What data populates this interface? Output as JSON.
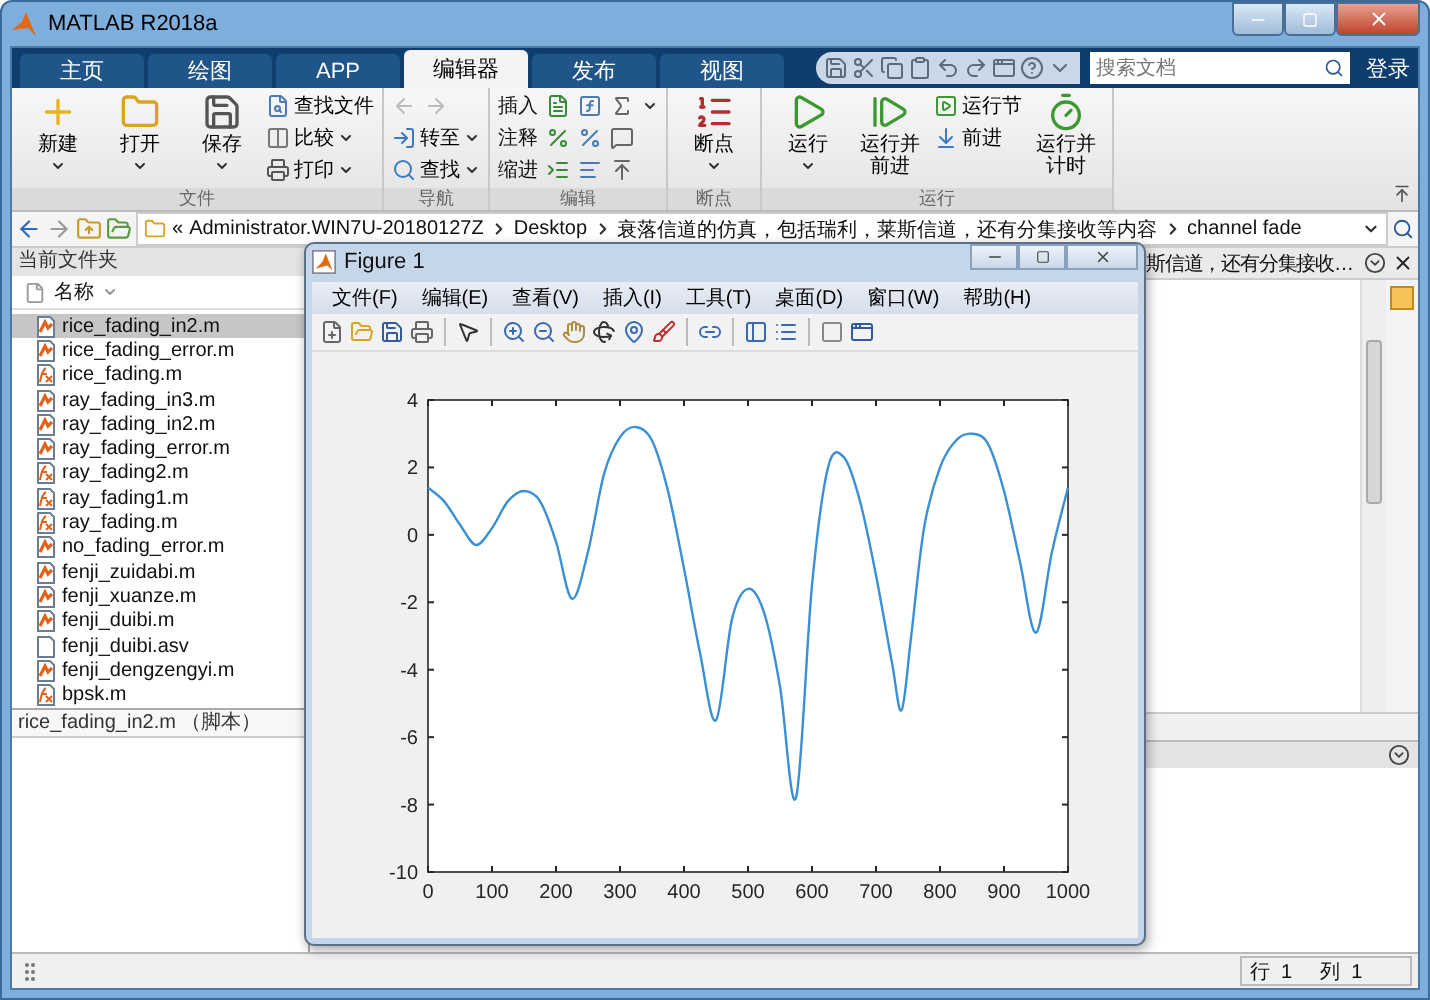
{
  "window": {
    "title": "MATLAB R2018a"
  },
  "tabs": [
    {
      "label": "主页",
      "selected": false
    },
    {
      "label": "绘图",
      "selected": false
    },
    {
      "label": "APP",
      "selected": false
    },
    {
      "label": "编辑器",
      "selected": true
    },
    {
      "label": "发布",
      "selected": false
    },
    {
      "label": "视图",
      "selected": false
    }
  ],
  "search": {
    "placeholder": "搜索文档"
  },
  "login": "登录",
  "ribbon": [
    {
      "title": "文件",
      "columns": [
        {
          "kind": "large",
          "label": "新建",
          "dropdown": true
        },
        {
          "kind": "large",
          "label": "打开",
          "dropdown": true
        },
        {
          "kind": "large",
          "label": "保存",
          "dropdown": true
        },
        {
          "kind": "stack",
          "rows": [
            {
              "kind": "button",
              "label": "查找文件",
              "dropdown": false
            },
            {
              "kind": "button",
              "label": "比较",
              "dropdown": true
            },
            {
              "kind": "button",
              "label": "打印",
              "dropdown": true
            }
          ]
        }
      ]
    },
    {
      "title": "导航",
      "columns": [
        {
          "kind": "stack",
          "rows": [
            {
              "kind": "arrows",
              "disabled": true
            },
            {
              "kind": "button",
              "label": "转至",
              "dropdown": true
            },
            {
              "kind": "button",
              "label": "查找",
              "dropdown": true
            }
          ]
        }
      ]
    },
    {
      "title": "编辑",
      "columns": [
        {
          "kind": "stack",
          "rows": [
            {
              "kind": "edit",
              "label": "插入",
              "dropdown": true
            },
            {
              "kind": "edit",
              "label": "注释",
              "dropdown": false
            },
            {
              "kind": "edit",
              "label": "缩进",
              "dropdown": false
            }
          ]
        }
      ]
    },
    {
      "title": "断点",
      "columns": [
        {
          "kind": "large",
          "label": "断点",
          "dropdown": true
        }
      ]
    },
    {
      "title": "运行",
      "columns": [
        {
          "kind": "large",
          "label": "运行",
          "dropdown": true
        },
        {
          "kind": "large",
          "label": "运行并前进",
          "dropdown": false
        },
        {
          "kind": "stack",
          "rows": [
            {
              "kind": "button",
              "label": "运行节",
              "dropdown": false
            },
            {
              "kind": "button",
              "label": "前进",
              "dropdown": false
            }
          ]
        },
        {
          "kind": "large",
          "label": "运行并计时",
          "dropdown": false
        }
      ]
    }
  ],
  "address": [
    "«",
    "Administrator.WIN7U-20180127Z",
    "Desktop",
    "衰落信道的仿真，包括瑞利，莱斯信道，还有分集接收等内容",
    "channel fade"
  ],
  "files_panel": {
    "title": "当前文件夹",
    "column": "名称",
    "files": [
      {
        "name": "rice_fading_in2.m",
        "kind": "script",
        "selected": true
      },
      {
        "name": "rice_fading_error.m",
        "kind": "script",
        "selected": false
      },
      {
        "name": "rice_fading.m",
        "kind": "function",
        "selected": false
      },
      {
        "name": "ray_fading_in3.m",
        "kind": "script",
        "selected": false
      },
      {
        "name": "ray_fading_in2.m",
        "kind": "script",
        "selected": false
      },
      {
        "name": "ray_fading_error.m",
        "kind": "script",
        "selected": false
      },
      {
        "name": "ray_fading2.m",
        "kind": "function",
        "selected": false
      },
      {
        "name": "ray_fading1.m",
        "kind": "function",
        "selected": false
      },
      {
        "name": "ray_fading.m",
        "kind": "function",
        "selected": false
      },
      {
        "name": "no_fading_error.m",
        "kind": "script",
        "selected": false
      },
      {
        "name": "fenji_zuidabi.m",
        "kind": "script",
        "selected": false
      },
      {
        "name": "fenji_xuanze.m",
        "kind": "script",
        "selected": false
      },
      {
        "name": "fenji_duibi.m",
        "kind": "script",
        "selected": false
      },
      {
        "name": "fenji_duibi.asv",
        "kind": "plain",
        "selected": false
      },
      {
        "name": "fenji_dengzengyi.m",
        "kind": "script",
        "selected": false
      },
      {
        "name": "bpsk.m",
        "kind": "function",
        "selected": false
      }
    ],
    "details": "rice_fading_in2.m （脚本）"
  },
  "editor": {
    "tab_title": "斯信道，还有分集接收…"
  },
  "status_bar": [
    {
      "label": "行",
      "value": "1"
    },
    {
      "label": "列",
      "value": "1"
    }
  ],
  "figure": {
    "title": "Figure 1",
    "menu": [
      "文件(F)",
      "编辑(E)",
      "查看(V)",
      "插入(I)",
      "工具(T)",
      "桌面(D)",
      "窗口(W)",
      "帮助(H)"
    ],
    "chart_data": {
      "type": "line",
      "xlim": [
        0,
        1000
      ],
      "ylim": [
        -10,
        4
      ],
      "xticks": [
        0,
        100,
        200,
        300,
        400,
        500,
        600,
        700,
        800,
        900,
        1000
      ],
      "yticks": [
        -10,
        -8,
        -6,
        -4,
        -2,
        0,
        2,
        4
      ],
      "x": [
        0,
        25,
        50,
        75,
        100,
        125,
        150,
        175,
        200,
        225,
        250,
        275,
        300,
        325,
        350,
        375,
        400,
        425,
        450,
        475,
        500,
        525,
        550,
        575,
        600,
        625,
        650,
        675,
        700,
        725,
        740,
        755,
        775,
        800,
        825,
        850,
        875,
        900,
        925,
        950,
        975,
        1000
      ],
      "series": [
        {
          "color": "#3b8fd4",
          "values": [
            1.4,
            1.0,
            0.3,
            -0.3,
            0.2,
            1.0,
            1.3,
            1.0,
            -0.2,
            -1.9,
            -0.5,
            1.8,
            2.9,
            3.2,
            2.8,
            1.3,
            -1.0,
            -3.5,
            -5.5,
            -2.5,
            -1.6,
            -2.3,
            -4.5,
            -7.8,
            -1.5,
            2.0,
            2.3,
            1.0,
            -1.2,
            -3.8,
            -5.2,
            -3.0,
            0.2,
            2.0,
            2.8,
            3.0,
            2.7,
            1.3,
            -0.8,
            -2.9,
            -0.5,
            1.4
          ]
        }
      ]
    }
  }
}
